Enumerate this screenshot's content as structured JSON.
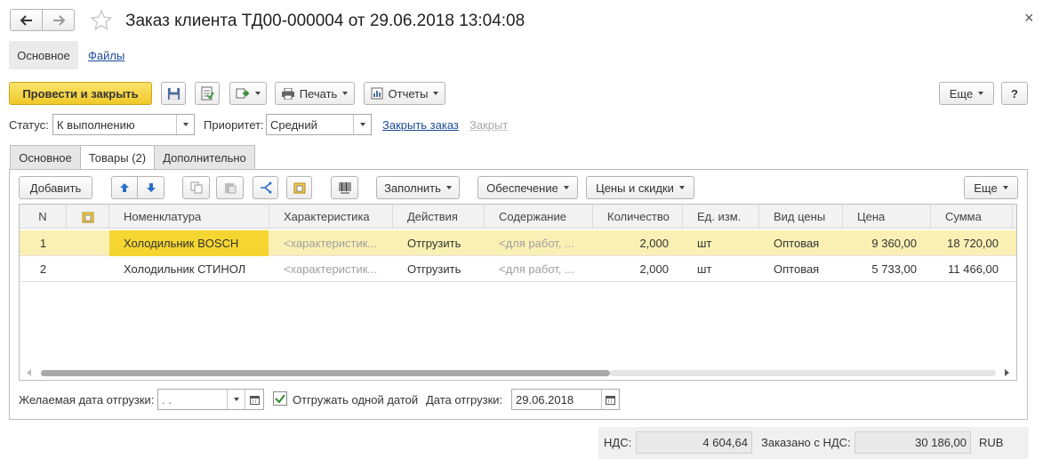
{
  "window": {
    "title": "Заказ клиента ТД00-000004 от 29.06.2018 13:04:08",
    "close_glyph": "×"
  },
  "nav": {
    "main_label": "Основное",
    "files_label": "Файлы"
  },
  "toolbar": {
    "post_close_label": "Провести и закрыть",
    "print_label": "Печать",
    "reports_label": "Отчеты",
    "more_label": "Еще",
    "help_label": "?"
  },
  "status_row": {
    "status_label": "Статус:",
    "status_value": "К выполнению",
    "priority_label": "Приоритет:",
    "priority_value": "Средний",
    "close_order_label": "Закрыть заказ",
    "closed_label": "Закрыт"
  },
  "tabs": [
    {
      "label": "Основное"
    },
    {
      "label": "Товары (2)"
    },
    {
      "label": "Дополнительно"
    }
  ],
  "table_toolbar": {
    "add_label": "Добавить",
    "fill_label": "Заполнить",
    "supply_label": "Обеспечение",
    "prices_label": "Цены и скидки",
    "more_label": "Еще"
  },
  "table": {
    "columns": [
      "N",
      "",
      "Номенклатура",
      "Характеристика",
      "Действия",
      "Содержание",
      "Количество",
      "Ед. изм.",
      "Вид цены",
      "Цена",
      "Сумма"
    ],
    "rows": [
      {
        "n": "1",
        "item": "Холодильник BOSCH",
        "characteristic": "<характеристик...",
        "action": "Отгрузить",
        "content": "<для работ, ...",
        "qty": "2,000",
        "unit": "шт",
        "price_type": "Оптовая",
        "price": "9 360,00",
        "sum": "18 720,00"
      },
      {
        "n": "2",
        "item": "Холодильник СТИНОЛ",
        "characteristic": "<характеристик...",
        "action": "Отгрузить",
        "content": "<для работ, ...",
        "qty": "2,000",
        "unit": "шт",
        "price_type": "Оптовая",
        "price": "5 733,00",
        "sum": "11 466,00"
      }
    ]
  },
  "shipping": {
    "desired_date_label": "Желаемая дата отгрузки:",
    "desired_date_value": " .  .",
    "single_date_label": "Отгружать одной датой",
    "single_date_checked": true,
    "ship_date_label": "Дата отгрузки:",
    "ship_date_value": "29.06.2018"
  },
  "totals": {
    "vat_label": "НДС:",
    "vat_value": "4 604,64",
    "ordered_label": "Заказано с НДС:",
    "ordered_value": "30 186,00",
    "currency": "RUB"
  },
  "colors": {
    "accent_yellow": "#f5d33b",
    "selected_row": "#fbf0b4",
    "selected_cell": "#f5d530",
    "link": "#1c4c99"
  }
}
